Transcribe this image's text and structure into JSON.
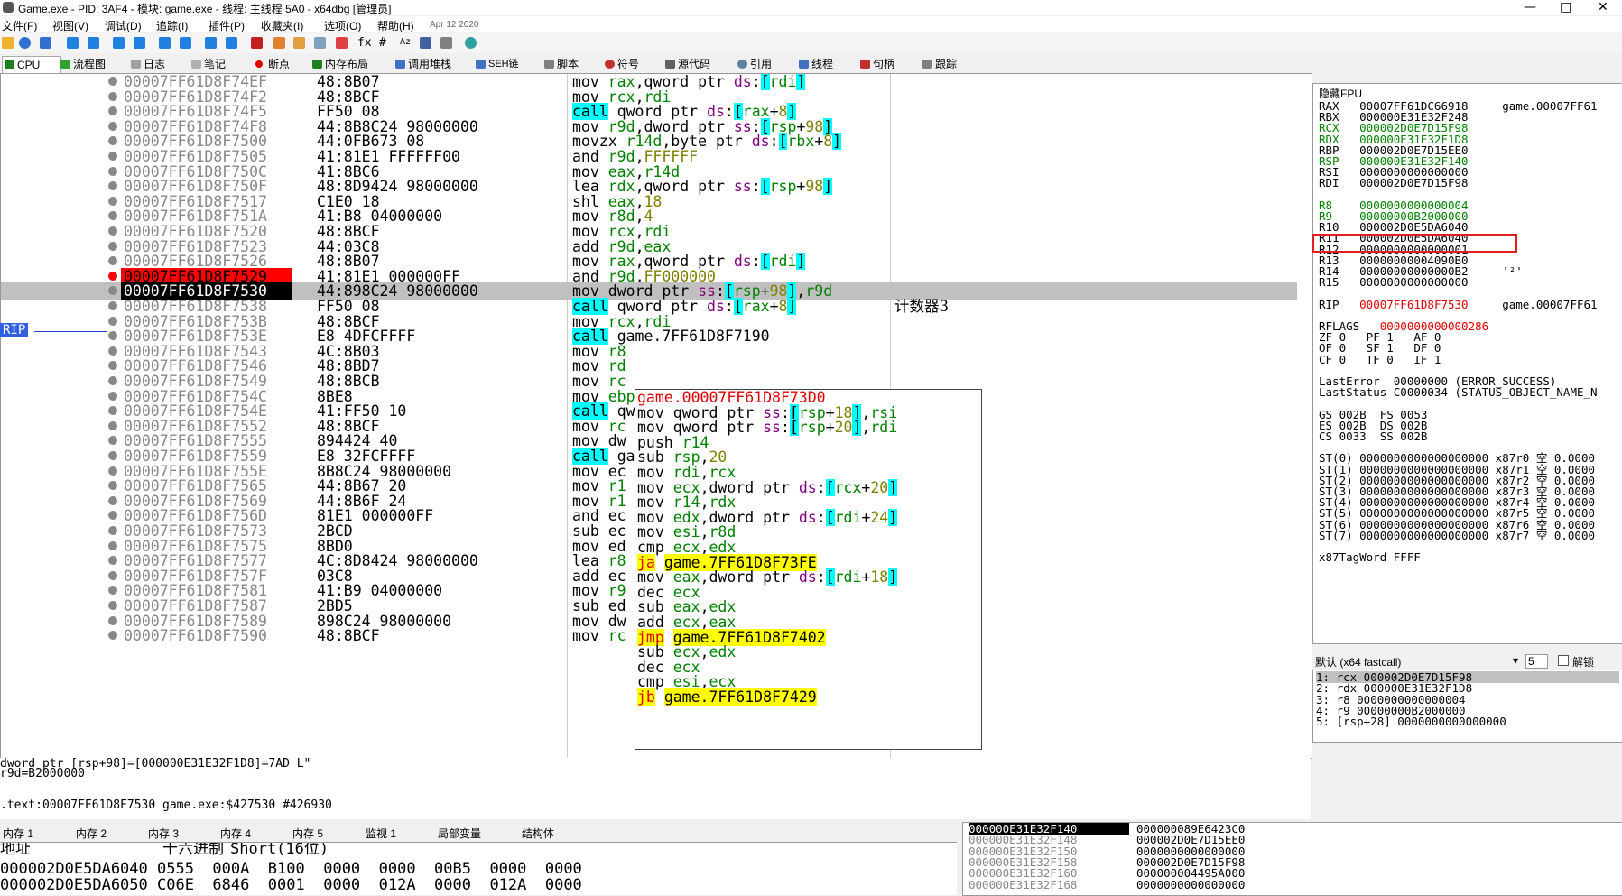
{
  "window": {
    "title": "Game.exe - PID: 3AF4 - 模块: game.exe - 线程: 主线程 5A0 - x64dbg [管理员]"
  },
  "menu": [
    "文件(F)",
    "视图(V)",
    "调试(D)",
    "追踪(I)",
    "插件(P)",
    "收藏夹(I)",
    "选项(O)",
    "帮助(H)",
    "Apr 12 2020"
  ],
  "tabs": [
    "CPU",
    "流程图",
    "日志",
    "笔记",
    "断点",
    "内存布局",
    "调用堆栈",
    "SEH链",
    "脚本",
    "符号",
    "源代码",
    "引用",
    "线程",
    "句柄",
    "跟踪"
  ],
  "disasm": [
    {
      "addr": "00007FF61D8F74EF",
      "bytes": "48:8B07",
      "ins": "mov rax,qword ptr ds:[rdi]"
    },
    {
      "addr": "00007FF61D8F74F2",
      "bytes": "48:8BCF",
      "ins": "mov rcx,rdi"
    },
    {
      "addr": "00007FF61D8F74F5",
      "bytes": "FF50 08",
      "ins": "call qword ptr ds:[rax+8]",
      "k": "call"
    },
    {
      "addr": "00007FF61D8F74F8",
      "bytes": "44:8B8C24 98000000",
      "ins": "mov r9d,dword ptr ss:[rsp+98]"
    },
    {
      "addr": "00007FF61D8F7500",
      "bytes": "44:0FB673 08",
      "ins": "movzx r14d,byte ptr ds:[rbx+8]"
    },
    {
      "addr": "00007FF61D8F7505",
      "bytes": "41:81E1 FFFFFF00",
      "ins": "and r9d,FFFFFF"
    },
    {
      "addr": "00007FF61D8F750C",
      "bytes": "41:8BC6",
      "ins": "mov eax,r14d"
    },
    {
      "addr": "00007FF61D8F750F",
      "bytes": "48:8D9424 98000000",
      "ins": "lea rdx,qword ptr ss:[rsp+98]"
    },
    {
      "addr": "00007FF61D8F7517",
      "bytes": "C1E0 18",
      "ins": "shl eax,18"
    },
    {
      "addr": "00007FF61D8F751A",
      "bytes": "41:B8 04000000",
      "ins": "mov r8d,4"
    },
    {
      "addr": "00007FF61D8F7520",
      "bytes": "48:8BCF",
      "ins": "mov rcx,rdi"
    },
    {
      "addr": "00007FF61D8F7523",
      "bytes": "44:03C8",
      "ins": "add r9d,eax"
    },
    {
      "addr": "00007FF61D8F7526",
      "bytes": "48:8B07",
      "ins": "mov rax,qword ptr ds:[rdi]"
    },
    {
      "addr": "00007FF61D8F7529",
      "bytes": "41:81E1 000000FF",
      "ins": "and r9d,FF000000",
      "bp": true
    },
    {
      "addr": "00007FF61D8F7530",
      "bytes": "44:898C24 98000000",
      "ins": "mov dword ptr ss:[rsp+98],r9d",
      "cur": true
    },
    {
      "addr": "00007FF61D8F7538",
      "bytes": "FF50 08",
      "ins": "call qword ptr ds:[rax+8]",
      "k": "call",
      "cmt": "计数器3"
    },
    {
      "addr": "00007FF61D8F753B",
      "bytes": "48:8BCF",
      "ins": "mov rcx,rdi"
    },
    {
      "addr": "00007FF61D8F753E",
      "bytes": "E8 4DFCFFFF",
      "ins": "call game.7FF61D8F7190",
      "k": "call"
    },
    {
      "addr": "00007FF61D8F7543",
      "bytes": "4C:8B03",
      "ins": "mov r8"
    },
    {
      "addr": "00007FF61D8F7546",
      "bytes": "48:8BD7",
      "ins": "mov rd"
    },
    {
      "addr": "00007FF61D8F7549",
      "bytes": "48:8BCB",
      "ins": "mov rc"
    },
    {
      "addr": "00007FF61D8F754C",
      "bytes": "8BE8",
      "ins": "mov ebp"
    },
    {
      "addr": "00007FF61D8F754E",
      "bytes": "41:FF50 10",
      "ins": "call qw",
      "k": "call"
    },
    {
      "addr": "00007FF61D8F7552",
      "bytes": "48:8BCF",
      "ins": "mov rc"
    },
    {
      "addr": "00007FF61D8F7555",
      "bytes": "894424 40",
      "ins": "mov dw"
    },
    {
      "addr": "00007FF61D8F7559",
      "bytes": "E8 32FCFFFF",
      "ins": "call ga",
      "k": "call"
    },
    {
      "addr": "00007FF61D8F755E",
      "bytes": "8B8C24 98000000",
      "ins": "mov ec"
    },
    {
      "addr": "00007FF61D8F7565",
      "bytes": "44:8B67 20",
      "ins": "mov r1"
    },
    {
      "addr": "00007FF61D8F7569",
      "bytes": "44:8B6F 24",
      "ins": "mov r1"
    },
    {
      "addr": "00007FF61D8F756D",
      "bytes": "81E1 000000FF",
      "ins": "and ec"
    },
    {
      "addr": "00007FF61D8F7573",
      "bytes": "2BCD",
      "ins": "sub ec"
    },
    {
      "addr": "00007FF61D8F7575",
      "bytes": "8BD0",
      "ins": "mov ed"
    },
    {
      "addr": "00007FF61D8F7577",
      "bytes": "4C:8D8424 98000000",
      "ins": "lea r8"
    },
    {
      "addr": "00007FF61D8F757F",
      "bytes": "03C8",
      "ins": "add ec"
    },
    {
      "addr": "00007FF61D8F7581",
      "bytes": "41:B9 04000000",
      "ins": "mov r9"
    },
    {
      "addr": "00007FF61D8F7587",
      "bytes": "2BD5",
      "ins": "sub ed"
    },
    {
      "addr": "00007FF61D8F7589",
      "bytes": "898C24 98000000",
      "ins": "mov dw"
    },
    {
      "addr": "00007FF61D8F7590",
      "bytes": "48:8BCF",
      "ins": "mov rc"
    }
  ],
  "popup": [
    {
      "t": "game.00007FF61D8F73D0",
      "c": "red"
    },
    {
      "t": "mov qword ptr ss:[rsp+18],rsi"
    },
    {
      "t": "mov qword ptr ss:[rsp+20],rdi"
    },
    {
      "t": "push r14"
    },
    {
      "t": "sub rsp,20"
    },
    {
      "t": "mov rdi,rcx"
    },
    {
      "t": "mov ecx,dword ptr ds:[rcx+20]"
    },
    {
      "t": "mov r14,rdx"
    },
    {
      "t": "mov edx,dword ptr ds:[rdi+24]"
    },
    {
      "t": "mov esi,r8d"
    },
    {
      "t": "cmp ecx,edx"
    },
    {
      "t": "ja game.7FF61D8F73FE",
      "c": "j"
    },
    {
      "t": "mov eax,dword ptr ds:[rdi+18]"
    },
    {
      "t": "dec ecx"
    },
    {
      "t": "sub eax,edx"
    },
    {
      "t": "add ecx,eax"
    },
    {
      "t": "jmp game.7FF61D8F7402",
      "c": "j"
    },
    {
      "t": "sub ecx,edx"
    },
    {
      "t": "dec ecx"
    },
    {
      "t": "cmp esi,ecx"
    },
    {
      "t": "jb game.7FF61D8F7429",
      "c": "j"
    }
  ],
  "fpu": {
    "header": "隐藏FPU",
    "lines": [
      "RAX   00007FF61DC66918     game.00007FF61",
      "RBX   000000E31E32F248",
      "RCX   000002D0E7D15F98",
      "RDX   000000E31E32F1D8",
      "RBP   000002D0E7D15EE0",
      "RSP   000000E31E32F140",
      "RSI   0000000000000000",
      "RDI   000002D0E7D15F98",
      "",
      "R8    0000000000000004",
      "R9    00000000B2000000",
      "R10   000002D0E5DA6040",
      "R11   000002D0E5DA6040",
      "R12   0000000000000001",
      "R13   00000000004090B0",
      "R14   00000000000000B2     '²'",
      "R15   0000000000000000",
      "",
      "RIP   00007FF61D8F7530     game.00007FF61",
      "",
      "RFLAGS   0000000000000286",
      "ZF 0   PF 1   AF 0",
      "OF 0   SF 1   DF 0",
      "CF 0   TF 0   IF 1",
      "",
      "LastError  00000000 (ERROR_SUCCESS)",
      "LastStatus C0000034 (STATUS_OBJECT_NAME_N",
      "",
      "GS 002B  FS 0053",
      "ES 002B  DS 002B",
      "CS 0033  SS 002B",
      "",
      "ST(0) 0000000000000000000 x87r0 空 0.0000",
      "ST(1) 0000000000000000000 x87r1 空 0.0000",
      "ST(2) 0000000000000000000 x87r2 空 0.0000",
      "ST(3) 0000000000000000000 x87r3 空 0.0000",
      "ST(4) 0000000000000000000 x87r4 空 0.0000",
      "ST(5) 0000000000000000000 x87r5 空 0.0000",
      "ST(6) 0000000000000000000 x87r6 空 0.0000",
      "ST(7) 0000000000000000000 x87r7 空 0.0000",
      "",
      "x87TagWord FFFF"
    ]
  },
  "callconv": {
    "label": "默认 (x64 fastcall)",
    "count": "5",
    "unlock": "解锁",
    "args": [
      "1: rcx 000002D0E7D15F98",
      "2: rdx 000000E31E32F1D8",
      "3: r8 0000000000000004",
      "4: r9 00000000B2000000",
      "5: [rsp+28] 0000000000000000"
    ]
  },
  "info": [
    "dword ptr [rsp+98]=[000000E31E32F1D8]=7AD L\"",
    "r9d=B2000000",
    "",
    ".text:00007FF61D8F7530 game.exe:$427530 #426930"
  ],
  "bottom_tabs": [
    "内存 1",
    "内存 2",
    "内存 3",
    "内存 4",
    "内存 5",
    "监视 1",
    "局部变量",
    "结构体"
  ],
  "dump": {
    "header_addr": "地址",
    "header_hex": "十六进制",
    "header_fmt": "Short(16位)",
    "rows": [
      "000002D0E5DA6040 0555  000A  B100  0000  0000  00B5  0000  0000",
      "000002D0E5DA6050 C06E  6846  0001  0000  012A  0000  012A  0000"
    ]
  },
  "stack": [
    {
      "a": "000000E31E32F140",
      "v": "000000089E6423C0",
      "sel": true
    },
    {
      "a": "000000E31E32F148",
      "v": "000002D0E7D15EE0"
    },
    {
      "a": "000000E31E32F150",
      "v": "0000000000000000"
    },
    {
      "a": "000000E31E32F158",
      "v": "000002D0E7D15F98"
    },
    {
      "a": "000000E31E32F160",
      "v": "000000004495A000"
    },
    {
      "a": "000000E31E32F168",
      "v": "0000000000000000"
    }
  ],
  "rip_label": "RIP",
  "colors": {
    "breakpoint": "#ff0000",
    "call_bg": "#00ffff",
    "jump_bg": "#ffff00",
    "register": "#008000",
    "highlight_box": "#e02020"
  }
}
